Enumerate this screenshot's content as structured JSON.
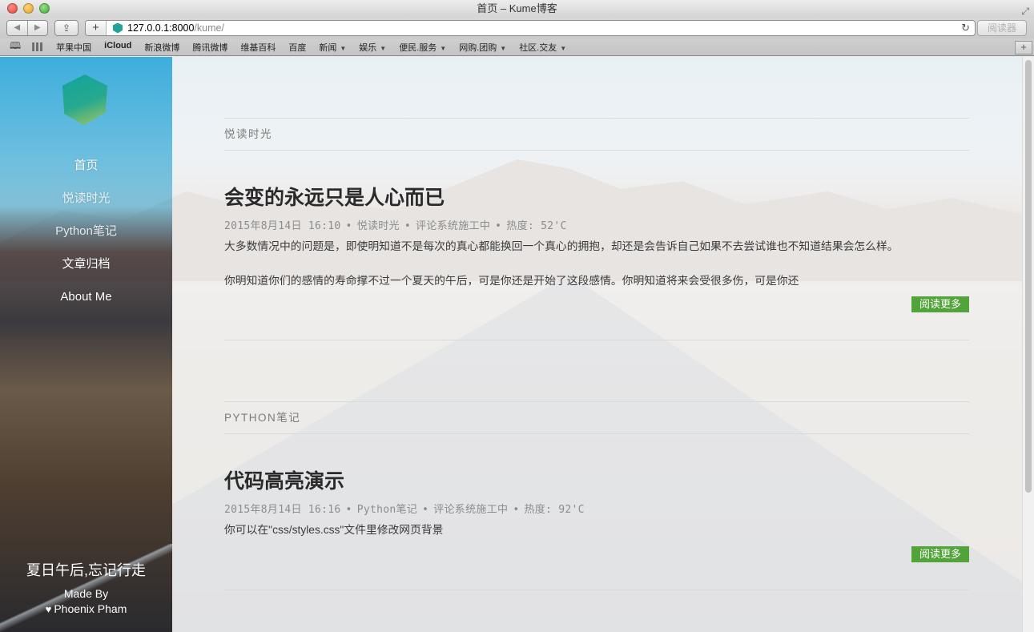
{
  "window": {
    "title": "首页 – Kume博客"
  },
  "toolbar": {
    "back_label": "◀",
    "forward_label": "▶",
    "share_label": "⇪",
    "add_label": "+",
    "url_host": "127.0.0.1:8000",
    "url_path": "/kume/",
    "reload_label": "↻",
    "reader_label": "阅读器"
  },
  "bookmarks": {
    "items": [
      {
        "label": "苹果中国",
        "bold": false,
        "menu": false
      },
      {
        "label": "iCloud",
        "bold": true,
        "menu": false
      },
      {
        "label": "新浪微博",
        "bold": false,
        "menu": false
      },
      {
        "label": "腾讯微博",
        "bold": false,
        "menu": false
      },
      {
        "label": "维基百科",
        "bold": false,
        "menu": false
      },
      {
        "label": "百度",
        "bold": false,
        "menu": false
      },
      {
        "label": "新闻",
        "bold": false,
        "menu": true
      },
      {
        "label": "娱乐",
        "bold": false,
        "menu": true
      },
      {
        "label": "便民.服务",
        "bold": false,
        "menu": true
      },
      {
        "label": "网购.团购",
        "bold": false,
        "menu": true
      },
      {
        "label": "社区.交友",
        "bold": false,
        "menu": true
      }
    ],
    "add_label": "+"
  },
  "sidebar": {
    "nav": [
      {
        "label": "首页"
      },
      {
        "label": "悦读时光"
      },
      {
        "label": "Python笔记"
      },
      {
        "label": "文章归档"
      },
      {
        "label": "About Me"
      }
    ],
    "slogan": "夏日午后,忘记行走",
    "made_by": "Made By",
    "author": "Phoenix Pham",
    "heart": "♥"
  },
  "posts": [
    {
      "category": "悦读时光",
      "title": "会变的永远只是人心而已",
      "date": "2015年8月14日 16:10",
      "meta_category": "悦读时光",
      "comments": "评论系统施工中",
      "heat": "热度: 52'C",
      "excerpt": [
        "大多数情况中的问题是，即使明知道不是每次的真心都能换回一个真心的拥抱，却还是会告诉自己如果不去尝试谁也不知道结果会怎么样。",
        "你明知道你们的感情的寿命撑不过一个夏天的午后，可是你还是开始了这段感情。你明知道将来会受很多伤，可是你还"
      ],
      "read_more": "阅读更多"
    },
    {
      "category": "PYTHON笔记",
      "title": "代码高亮演示",
      "date": "2015年8月14日 16:16",
      "meta_category": "Python笔记",
      "comments": "评论系统施工中",
      "heat": "热度: 92'C",
      "excerpt": [
        "你可以在\"css/styles.css\"文件里修改网页背景"
      ],
      "read_more": "阅读更多"
    }
  ],
  "meta_separator": "•"
}
